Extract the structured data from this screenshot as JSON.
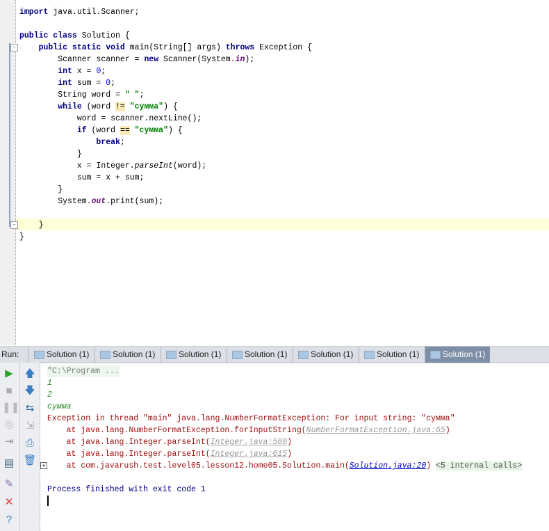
{
  "code_lines": [
    [
      [
        "import",
        "kw"
      ],
      [
        " java.util.Scanner;",
        ""
      ]
    ],
    [],
    [
      [
        "public class",
        "kw"
      ],
      [
        " Solution {",
        ""
      ]
    ],
    [
      [
        "    public static void",
        "kw"
      ],
      [
        " main(String[] args) ",
        ""
      ],
      [
        "throws",
        "kw"
      ],
      [
        " Exception {",
        ""
      ]
    ],
    [
      [
        "        Scanner scanner = ",
        ""
      ],
      [
        "new",
        "kw"
      ],
      [
        " Scanner(System.",
        ""
      ],
      [
        "in",
        "fld it"
      ],
      [
        ");",
        ""
      ]
    ],
    [
      [
        "        int",
        "kw"
      ],
      [
        " x = ",
        ""
      ],
      [
        "0",
        "num"
      ],
      [
        ";",
        ""
      ]
    ],
    [
      [
        "        int",
        "kw"
      ],
      [
        " sum = ",
        ""
      ],
      [
        "0",
        "num"
      ],
      [
        ";",
        ""
      ]
    ],
    [
      [
        "        String word = ",
        ""
      ],
      [
        "\" \"",
        "str"
      ],
      [
        ";",
        ""
      ]
    ],
    [
      [
        "        while",
        "kw"
      ],
      [
        " (word ",
        ""
      ],
      [
        "!=",
        "hl"
      ],
      [
        " ",
        ""
      ],
      [
        "\"сумма\"",
        "str"
      ],
      [
        ") {",
        ""
      ]
    ],
    [
      [
        "            word = scanner.nextLine();",
        ""
      ]
    ],
    [
      [
        "            if",
        "kw"
      ],
      [
        " (word ",
        ""
      ],
      [
        "==",
        "hl"
      ],
      [
        " ",
        ""
      ],
      [
        "\"сумма\"",
        "str"
      ],
      [
        ") {",
        ""
      ]
    ],
    [
      [
        "                break",
        "kw"
      ],
      [
        ";",
        ""
      ]
    ],
    [
      [
        "            }",
        ""
      ]
    ],
    [
      [
        "            x = Integer.",
        ""
      ],
      [
        "parseInt",
        "it"
      ],
      [
        "(word);",
        ""
      ]
    ],
    [
      [
        "            sum = x + sum;",
        ""
      ]
    ],
    [
      [
        "        }",
        ""
      ]
    ],
    [
      [
        "        System.",
        ""
      ],
      [
        "out",
        "fld it"
      ],
      [
        ".print(sum);",
        ""
      ]
    ],
    [],
    [
      [
        "    }",
        ""
      ]
    ],
    [
      [
        "}",
        ""
      ]
    ]
  ],
  "run": {
    "label": "Run:",
    "tabs": [
      "Solution (1)",
      "Solution (1)",
      "Solution (1)",
      "Solution (1)",
      "Solution (1)",
      "Solution (1)",
      "Solution (1)"
    ],
    "active_tab": 6
  },
  "console": {
    "cmd": "\"C:\\Program ...",
    "inputs": [
      "1",
      "2",
      "сумма"
    ],
    "exception": "Exception in thread \"main\" java.lang.NumberFormatException: For input string: \"сумма\"",
    "trace": [
      {
        "prefix": "    at java.lang.NumberFormatException.forInputString(",
        "link": "NumberFormatException.java:65",
        "suffix": ")"
      },
      {
        "prefix": "    at java.lang.Integer.parseInt(",
        "link": "Integer.java:580",
        "suffix": ")"
      },
      {
        "prefix": "    at java.lang.Integer.parseInt(",
        "link": "Integer.java:615",
        "suffix": ")"
      },
      {
        "prefix": "    at com.javarush.test.level05.lesson12.home05.Solution.main(",
        "link": "Solution.java:20",
        "suffix": ")"
      }
    ],
    "internal_calls": "<5 internal calls>",
    "finished": "Process finished with exit code 1"
  }
}
